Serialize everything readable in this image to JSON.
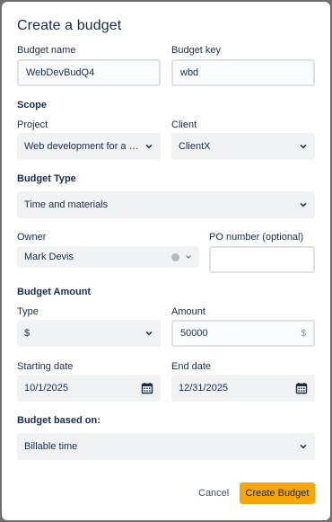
{
  "dialog": {
    "title": "Create a budget",
    "budget_name": {
      "label": "Budget name",
      "value": "WebDevBudQ4"
    },
    "budget_key": {
      "label": "Budget key",
      "value": "wbd"
    },
    "scope": {
      "heading": "Scope",
      "project": {
        "label": "Project",
        "value": "Web development for a m..."
      },
      "client": {
        "label": "Client",
        "value": "ClientX"
      }
    },
    "budget_type": {
      "heading": "Budget Type",
      "value": "Time and materials"
    },
    "owner": {
      "label": "Owner",
      "value": "Mark Devis"
    },
    "po_number": {
      "label": "PO number (optional)",
      "value": ""
    },
    "budget_amount": {
      "heading": "Budget Amount",
      "type": {
        "label": "Type",
        "value": "$"
      },
      "amount": {
        "label": "Amount",
        "value": "50000",
        "suffix": "$"
      }
    },
    "starting_date": {
      "label": "Starting date",
      "value": "10/1/2025"
    },
    "end_date": {
      "label": "End date",
      "value": "12/31/2025"
    },
    "based_on": {
      "heading": "Budget based on:",
      "value": "Billable time"
    },
    "actions": {
      "cancel": "Cancel",
      "create": "Create Budget"
    }
  },
  "icons": {
    "chevron": "chevron-down-icon",
    "calendar": "calendar-icon",
    "avatar": "avatar-dot"
  },
  "colors": {
    "primary_button": "#f5a60b",
    "backdrop": "#6f6f6f",
    "text": "#172b4d"
  }
}
